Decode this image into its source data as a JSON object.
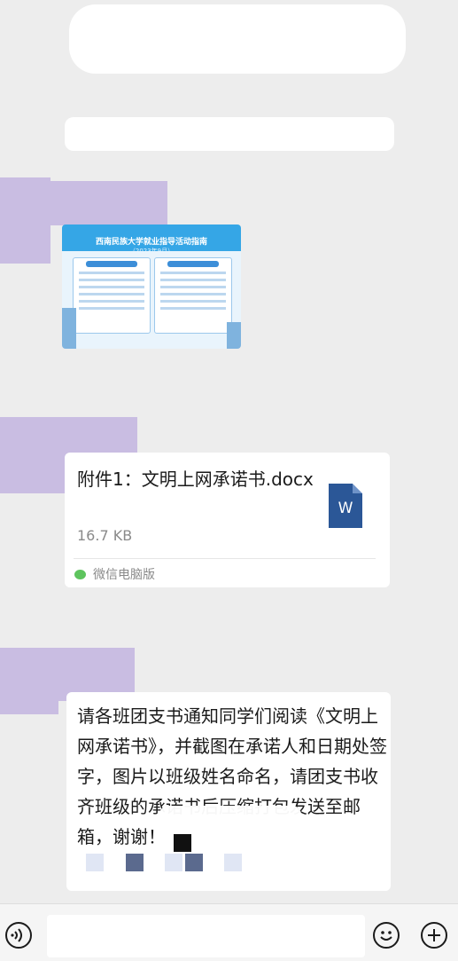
{
  "image_message": {
    "title": "西南民族大学就业指导活动指南",
    "subtitle": "（2023年9月）",
    "icon": "image-thumbnail"
  },
  "file_message": {
    "name": "附件1：文明上网承诺书.docx",
    "size": "16.7 KB",
    "source": "微信电脑版",
    "file_icon_letter": "W",
    "file_icon_color": "#2b5797"
  },
  "text_message": {
    "text": "请各班团支书通知同学们阅读《文明上网承诺书》，并截图在承诺人和日期处签字，图片以班级姓名命名，请团支书收齐班级的承诺书后压缩打包发送至邮箱，谢谢！"
  },
  "input_bar": {
    "voice_icon": "voice-icon",
    "emoji_icon": "emoji-icon",
    "plus_icon": "plus-icon"
  },
  "colors": {
    "background": "#ededed",
    "bubble": "#ffffff",
    "avatar": "#c9bde2",
    "wechat_green": "#5ec45e"
  }
}
